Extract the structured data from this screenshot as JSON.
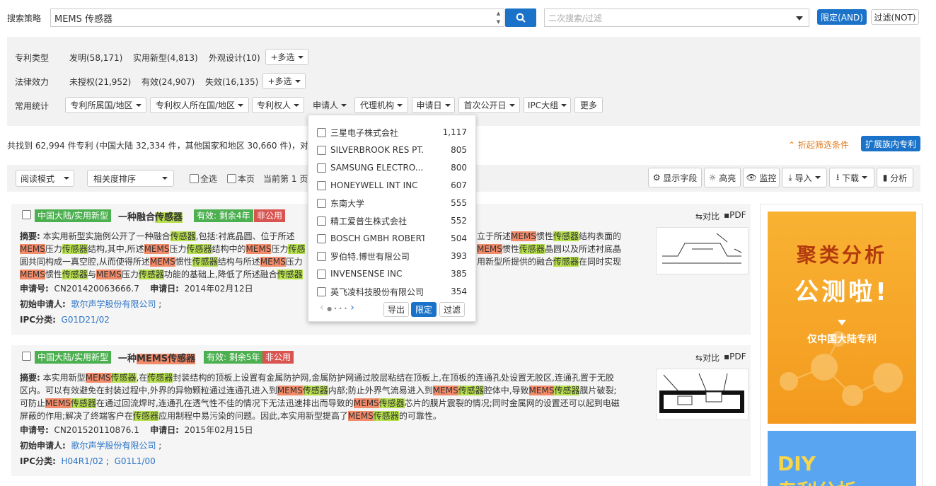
{
  "search": {
    "label": "搜索策略",
    "query": "MEMS 传感器",
    "secondary_placeholder": "二次搜索/过滤",
    "btn_and": "限定(AND)",
    "btn_not": "过滤(NOT)"
  },
  "filters": {
    "type_label": "专利类型",
    "types": [
      "发明(58,171)",
      "实用新型(4,813)",
      "外观设计(10)"
    ],
    "multi1": "+多选",
    "legal_label": "法律效力",
    "legal": [
      "未授权(21,952)",
      "有效(24,907)",
      "失效(16,135)"
    ],
    "multi2": "+多选",
    "stat_label": "常用统计",
    "stats": [
      "专利所属国/地区",
      "专利权人所在国/地区",
      "专利权人",
      "申请人",
      "代理机构",
      "申请日",
      "首次公开日",
      "IPC大组",
      "更多"
    ]
  },
  "summary": "共找到 62,994 件专利 (中国大陆 32,334 件，其他国家和地区 30,660 件)，对应",
  "collapse": "折起筛选条件",
  "expand": "扩展族内专利",
  "toolbar": {
    "mode": "阅读模式",
    "sort": "相关度排序",
    "all": "全选",
    "page": "本页",
    "current": "当前第 1 页",
    "fields": "显示字段",
    "highlight": "高亮",
    "monitor": "监控",
    "import": "导入",
    "download": "下载",
    "analyze": "分析"
  },
  "dropdown": {
    "items": [
      {
        "name": "三星电子株式会社",
        "count": "1,117"
      },
      {
        "name": "SILVERBROOK RES PT...",
        "count": "805"
      },
      {
        "name": "SAMSUNG ELECTRO...",
        "count": "800"
      },
      {
        "name": "HONEYWELL INT INC",
        "count": "607"
      },
      {
        "name": "东南大学",
        "count": "555"
      },
      {
        "name": "精工爱普生株式会社",
        "count": "552"
      },
      {
        "name": "BOSCH GMBH ROBERT",
        "count": "504"
      },
      {
        "name": "罗伯特.博世有限公司",
        "count": "393"
      },
      {
        "name": "INVENSENSE INC",
        "count": "385"
      },
      {
        "name": "英飞凌科技股份有限公司",
        "count": "354"
      }
    ],
    "export": "导出",
    "limit": "限定",
    "filter": "过滤"
  },
  "results": [
    {
      "tag_region": "中国大陆/实用新型",
      "title_pre": "一种融合",
      "title_hl": "传感器",
      "status": "有效: 剩余4年",
      "nonpublic": "非公用",
      "compare": "对比",
      "pdf": "PDF",
      "apno_label": "申请号:",
      "apno": "CN201420063666.7",
      "apdate_label": "申请日:",
      "apdate": "2014年02月12日",
      "applicant_label": "初始申请人:",
      "applicant": "歌尔声学股份有限公司",
      "ipc_label": "IPC分类:",
      "ipc": [
        "G01D21/02"
      ]
    },
    {
      "tag_region": "中国大陆/实用新型",
      "title_pre": "一种",
      "title_hl": "MEMS传感器",
      "status": "有效: 剩余5年",
      "nonpublic": "非公用",
      "compare": "对比",
      "pdf": "PDF",
      "apno_label": "申请号:",
      "apno": "CN201520110876.1",
      "apdate_label": "申请日:",
      "apdate": "2015年02月15日",
      "applicant_label": "初始申请人:",
      "applicant": "歌尔声学股份有限公司",
      "ipc_label": "IPC分类:",
      "ipc": [
        "H04R1/02",
        "G01L1/00"
      ]
    }
  ],
  "ad1": {
    "line1": "聚类分析",
    "line2": "公测啦!",
    "line3": "仅中国大陆专利"
  },
  "ad2": {
    "line1": "DIY",
    "line2": "专利分析"
  },
  "colors": {
    "primary": "#1a73c8",
    "green": "#4caf50",
    "red": "#d9534f",
    "orange": "#f28b69",
    "lime": "#b7e04d",
    "ad": "#f5a623"
  }
}
